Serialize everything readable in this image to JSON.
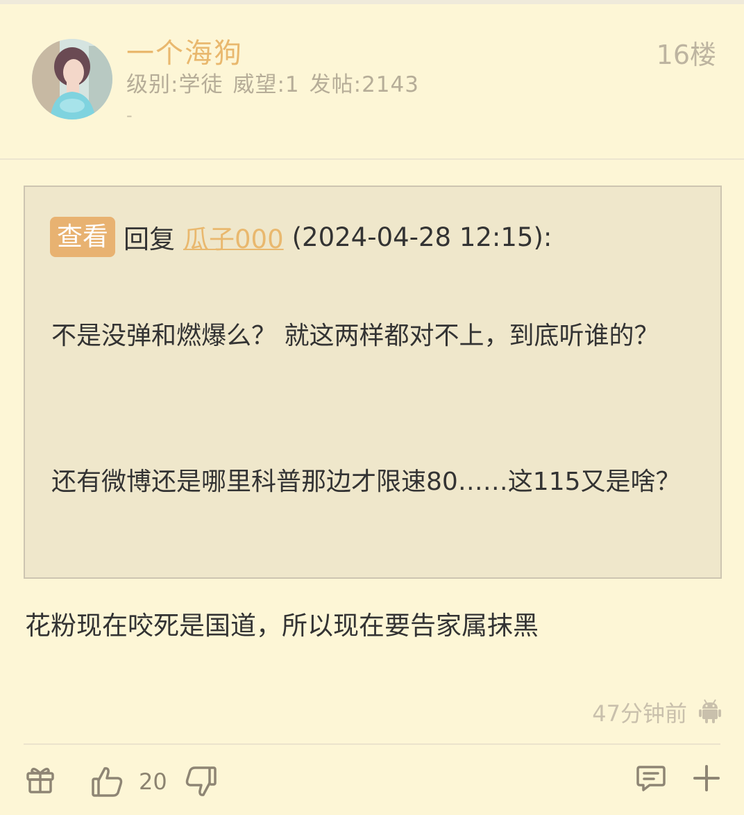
{
  "post": {
    "username": "一个海狗",
    "level": "级别:学徒",
    "prestige": "威望:1",
    "posts": "发帖:2143",
    "signature": "-",
    "floor": "16楼"
  },
  "quote": {
    "view_label": "查看",
    "reply_label": "回复",
    "reply_user": "瓜子000",
    "reply_time": "(2024-04-28 12:15):",
    "line1": "不是没弹和燃爆么？ 就这两样都对不上，到底听谁的？",
    "line2": "还有微博还是哪里科普那边才限速80……这115又是啥？"
  },
  "content": {
    "text": "花粉现在咬死是国道，所以现在要告家属抹黑"
  },
  "footer": {
    "time": "47分钟前",
    "platform_icon": "android-icon"
  },
  "actions": {
    "like_count": "20",
    "icons": [
      "gift-icon",
      "thumbs-up-icon",
      "thumbs-down-icon",
      "comment-icon",
      "plus-icon"
    ]
  },
  "colors": {
    "background": "#fdf6d6",
    "accent": "#e9b86e",
    "view_button": "#e8b271",
    "quote_background": "#efe7cb"
  }
}
